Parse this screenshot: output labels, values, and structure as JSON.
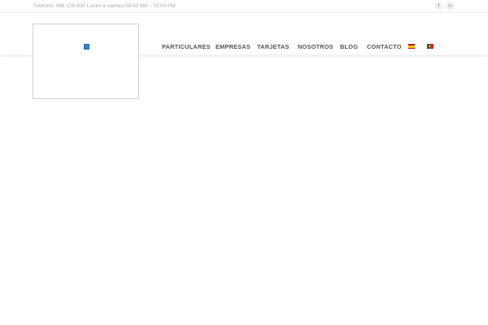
{
  "topbar": {
    "phone": "Teléfono: 986 129 000",
    "hours": "Lunes a viernes 08:00 AM – 15:00 PM",
    "social": [
      {
        "icon": "facebook-icon",
        "glyph": "f"
      },
      {
        "icon": "linkedin-icon",
        "glyph": "in"
      }
    ]
  },
  "nav": {
    "items": [
      "PARTICULARES",
      "EMPRESAS",
      "TARJETAS",
      "NOSOTROS",
      "BLOG",
      "CONTACTO"
    ]
  },
  "languages": [
    {
      "code": "es",
      "icon": "spain-flag-icon"
    },
    {
      "code": "pt",
      "icon": "portugal-flag-icon"
    }
  ],
  "colors": {
    "nav_text": "#555555",
    "topbar_text": "#a8a8a8",
    "logo_mark": "#3a84c6"
  }
}
